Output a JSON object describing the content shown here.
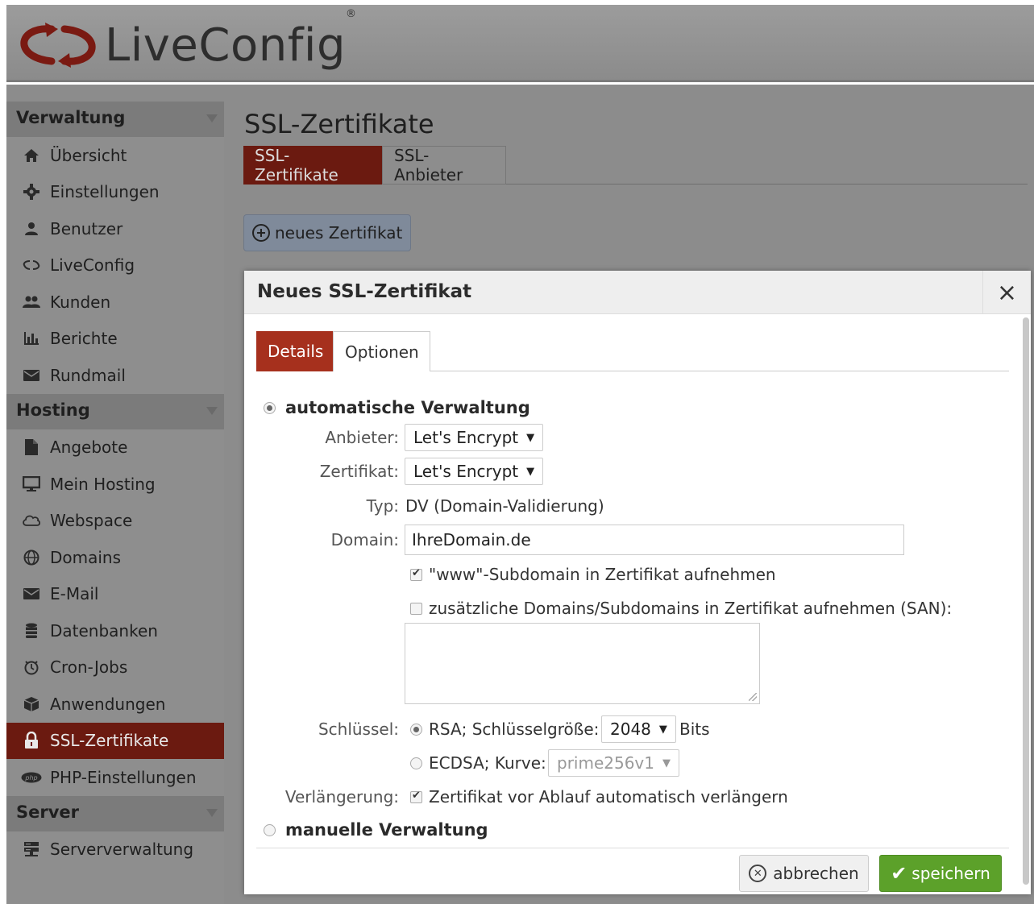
{
  "app": {
    "logo_text": "LiveConfig",
    "logo_reg": "®"
  },
  "sidebar": {
    "sections": [
      {
        "title": "Verwaltung"
      },
      {
        "title": "Hosting"
      },
      {
        "title": "Server"
      }
    ],
    "items": [
      {
        "label": "Übersicht",
        "icon": "home-icon"
      },
      {
        "label": "Einstellungen",
        "icon": "gear-icon"
      },
      {
        "label": "Benutzer",
        "icon": "user-icon"
      },
      {
        "label": "LiveConfig",
        "icon": "liveconfig-icon"
      },
      {
        "label": "Kunden",
        "icon": "users-icon"
      },
      {
        "label": "Berichte",
        "icon": "bar-chart-icon"
      },
      {
        "label": "Rundmail",
        "icon": "envelope-icon"
      },
      {
        "label": "Angebote",
        "icon": "document-icon"
      },
      {
        "label": "Mein Hosting",
        "icon": "monitor-icon"
      },
      {
        "label": "Webspace",
        "icon": "cloud-icon"
      },
      {
        "label": "Domains",
        "icon": "globe-icon"
      },
      {
        "label": "E-Mail",
        "icon": "envelope-icon"
      },
      {
        "label": "Datenbanken",
        "icon": "database-icon"
      },
      {
        "label": "Cron-Jobs",
        "icon": "clock-icon"
      },
      {
        "label": "Anwendungen",
        "icon": "box-icon"
      },
      {
        "label": "SSL-Zertifikate",
        "icon": "lock-icon"
      },
      {
        "label": "PHP-Einstellungen",
        "icon": "php-icon"
      },
      {
        "label": "Serververwaltung",
        "icon": "server-icon"
      }
    ]
  },
  "main": {
    "title": "SSL-Zertifikate",
    "tabs": [
      {
        "label": "SSL-Zertifikate"
      },
      {
        "label": "SSL-Anbieter"
      }
    ],
    "new_button": "neues Zertifikat"
  },
  "dialog": {
    "title": "Neues SSL-Zertifikat",
    "close": "×",
    "tabs": [
      {
        "label": "Details"
      },
      {
        "label": "Optionen"
      }
    ],
    "auto_label": "automatische Verwaltung",
    "provider_label": "Anbieter:",
    "provider_value": "Let's Encrypt",
    "cert_label": "Zertifikat:",
    "cert_value": "Let's Encrypt",
    "type_label": "Typ:",
    "type_value": "DV (Domain-Validierung)",
    "domain_label": "Domain:",
    "domain_value": "IhreDomain.de",
    "www_label": "\"www\"-Subdomain in Zertifikat aufnehmen",
    "san_label": "zusätzliche Domains/Subdomains in Zertifikat aufnehmen (SAN):",
    "key_label": "Schlüssel:",
    "rsa_label": "RSA; Schlüsselgröße:",
    "rsa_size": "2048",
    "bits_label": "Bits",
    "ecdsa_label": "ECDSA; Kurve:",
    "ecdsa_curve": "prime256v1",
    "renew_label": "Verlängerung:",
    "renew_text": "Zertifikat vor Ablauf automatisch verlängern",
    "manual_label": "manuelle Verwaltung",
    "cancel": "abbrechen",
    "save": "speichern"
  },
  "colors": {
    "active_tab": "#a6301d",
    "save": "#5ca12a",
    "sidebar_active": "#6b1a10"
  }
}
